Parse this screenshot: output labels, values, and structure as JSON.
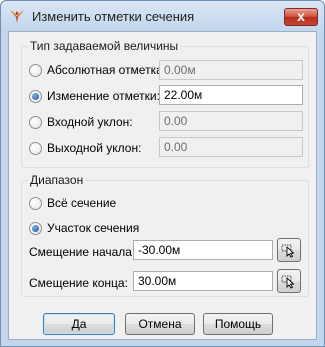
{
  "window": {
    "title": "Изменить отметки сечения",
    "close_label": "x"
  },
  "group_value_type": {
    "legend": "Тип задаваемой величины",
    "options": [
      {
        "label": "Абсолютная отметка:",
        "value": "0.00м",
        "checked": false,
        "enabled": false
      },
      {
        "label": "Изменение отметки:",
        "value": "22.00м",
        "checked": true,
        "enabled": true
      },
      {
        "label": "Входной уклон:",
        "value": "0.00",
        "checked": false,
        "enabled": false
      },
      {
        "label": "Выходной уклон:",
        "value": "0.00",
        "checked": false,
        "enabled": false
      }
    ]
  },
  "group_range": {
    "legend": "Диапазон",
    "options": [
      {
        "label": "Всё сечение",
        "checked": false
      },
      {
        "label": "Участок сечения",
        "checked": true
      }
    ],
    "start_offset": {
      "label": "Смещение начала:",
      "value": "-30.00м"
    },
    "end_offset": {
      "label": "Смещение конца:",
      "value": "30.00м"
    }
  },
  "buttons": {
    "ok": "Да",
    "cancel": "Отмена",
    "help": "Помощь"
  }
}
